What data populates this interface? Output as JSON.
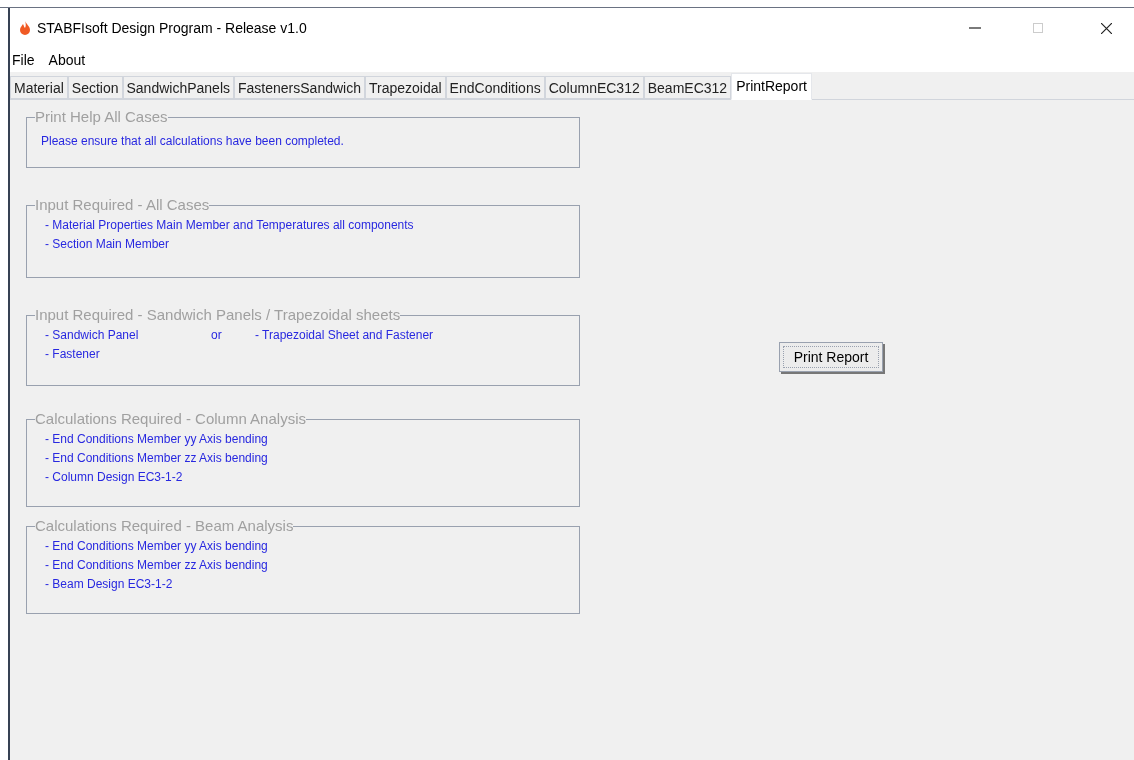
{
  "window": {
    "title": "STABFIsoft Design Program - Release v1.0"
  },
  "menu": [
    "File",
    "About"
  ],
  "tabs": [
    {
      "label": "Material",
      "selected": false
    },
    {
      "label": "Section",
      "selected": false
    },
    {
      "label": "SandwichPanels",
      "selected": false
    },
    {
      "label": "FastenersSandwich",
      "selected": false
    },
    {
      "label": "Trapezoidal",
      "selected": false
    },
    {
      "label": "EndConditions",
      "selected": false
    },
    {
      "label": "ColumnEC312",
      "selected": false
    },
    {
      "label": "BeamEC312",
      "selected": false
    },
    {
      "label": "PrintReport",
      "selected": true
    }
  ],
  "groups": [
    {
      "title": "Print Help All Cases",
      "lines": [
        [
          "Please ensure that all calculations have been completed."
        ]
      ]
    },
    {
      "title": "Input Required - All Cases",
      "lines": [
        [
          "- Material Properties Main Member and Temperatures all components"
        ],
        [
          "- Section Main Member"
        ]
      ]
    },
    {
      "title": "Input Required - Sandwich Panels / Trapezoidal sheets",
      "lines": [
        [
          "- Sandwich Panel",
          "or",
          "- Trapezoidal Sheet and Fastener"
        ],
        [
          "- Fastener"
        ]
      ]
    },
    {
      "title": "Calculations Required - Column Analysis",
      "lines": [
        [
          "- End Conditions Member yy Axis bending"
        ],
        [
          "- End Conditions Member zz Axis bending"
        ],
        [
          "- Column Design EC3-1-2"
        ]
      ]
    },
    {
      "title": "Calculations Required - Beam Analysis",
      "lines": [
        [
          "- End Conditions Member yy Axis bending"
        ],
        [
          "- End Conditions Member zz Axis bending"
        ],
        [
          "- Beam Design EC3-1-2"
        ]
      ]
    }
  ],
  "print_button": "Print Report"
}
